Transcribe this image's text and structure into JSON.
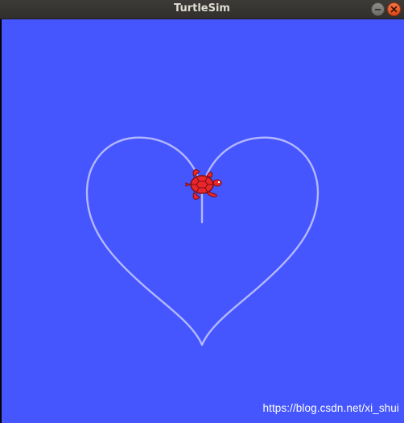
{
  "window": {
    "title": "TurtleSim",
    "canvas_color": "#4556ff",
    "pen_color": "#b3b8ff",
    "minimize_icon": "minimize-icon",
    "close_icon": "close-icon"
  },
  "turtle": {
    "color": "#e8262c",
    "outline_color": "#7a0d10",
    "icon": "turtle-icon"
  },
  "watermark": {
    "text": "https://blog.csdn.net/xi_shui"
  }
}
